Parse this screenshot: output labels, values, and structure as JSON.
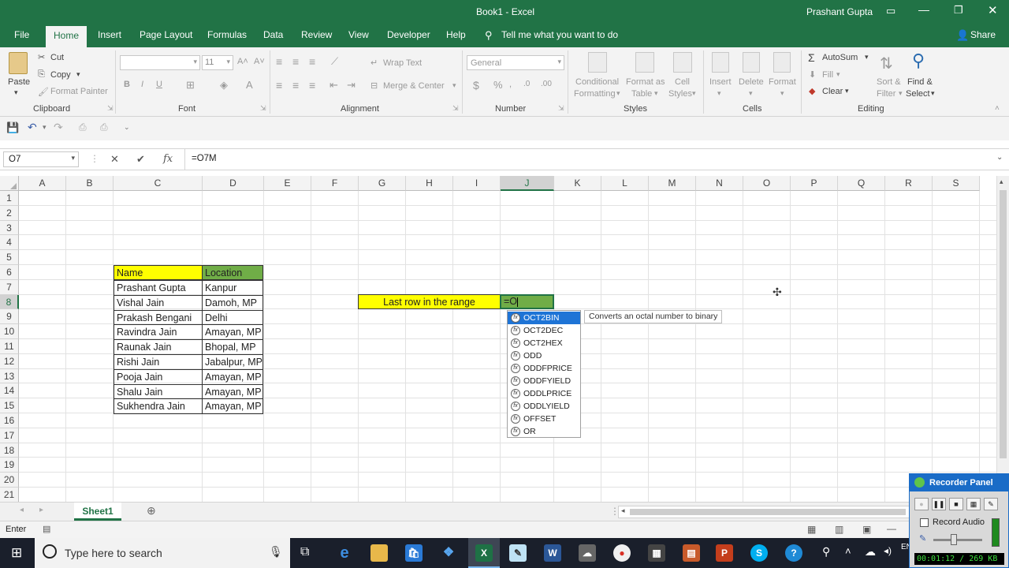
{
  "window": {
    "title": "Book1 - Excel",
    "user": "Prashant Gupta"
  },
  "tabs": [
    "File",
    "Home",
    "Insert",
    "Page Layout",
    "Formulas",
    "Data",
    "Review",
    "View",
    "Developer",
    "Help"
  ],
  "tell_me": "Tell me what you want to do",
  "share": "Share",
  "ribbon": {
    "clipboard": {
      "paste": "Paste",
      "cut": "Cut",
      "copy": "Copy",
      "format_painter": "Format Painter",
      "group": "Clipboard"
    },
    "font": {
      "size": "11",
      "bold": "B",
      "italic": "I",
      "underline": "U",
      "group": "Font"
    },
    "alignment": {
      "wrap_text": "Wrap Text",
      "merge_center": "Merge & Center",
      "group": "Alignment"
    },
    "number": {
      "format": "General",
      "currency": "$",
      "percent": "%",
      "group": "Number"
    },
    "styles": {
      "conditional": "Conditional",
      "formatting": "Formatting",
      "format_as": "Format as",
      "table": "Table",
      "cell": "Cell",
      "styles": "Styles",
      "group": "Styles"
    },
    "cells": {
      "insert": "Insert",
      "delete": "Delete",
      "format": "Format",
      "group": "Cells"
    },
    "editing": {
      "autosum": "AutoSum",
      "fill": "Fill",
      "clear": "Clear",
      "sort": "Sort &",
      "filter": "Filter",
      "find": "Find &",
      "select": "Select",
      "group": "Editing"
    }
  },
  "formula_bar": {
    "name_box": "O7",
    "cancel": "✕",
    "enter": "✔",
    "fx": "fx",
    "formula": "=O7M"
  },
  "columns": [
    "A",
    "B",
    "C",
    "D",
    "E",
    "F",
    "G",
    "H",
    "I",
    "J",
    "K",
    "L",
    "M",
    "N",
    "O",
    "P",
    "Q",
    "R",
    "S"
  ],
  "rows": [
    "1",
    "2",
    "3",
    "4",
    "5",
    "6",
    "7",
    "8",
    "9",
    "10",
    "11",
    "12",
    "13",
    "14",
    "15",
    "16",
    "17",
    "18",
    "19",
    "20",
    "21"
  ],
  "table": {
    "headers": [
      "Name",
      "Location"
    ],
    "rows": [
      [
        "Prashant Gupta",
        "Kanpur"
      ],
      [
        "Vishal Jain",
        "Damoh, MP"
      ],
      [
        "Prakash Bengani",
        "Delhi"
      ],
      [
        "Ravindra Jain",
        "Amayan, MP"
      ],
      [
        "Raunak Jain",
        "Bhopal, MP"
      ],
      [
        "Rishi Jain",
        "Jabalpur, MP"
      ],
      [
        "Pooja Jain",
        "Amayan, MP"
      ],
      [
        "Shalu Jain",
        "Amayan, MP"
      ],
      [
        "Sukhendra Jain",
        "Amayan, MP"
      ]
    ]
  },
  "label_cell": "Last row in the range",
  "editing_cell": "=O",
  "autocomplete": {
    "items": [
      "OCT2BIN",
      "OCT2DEC",
      "OCT2HEX",
      "ODD",
      "ODDFPRICE",
      "ODDFYIELD",
      "ODDLPRICE",
      "ODDLYIELD",
      "OFFSET",
      "OR"
    ],
    "selected_index": 0,
    "tooltip": "Converts an octal number to binary"
  },
  "sheet_tab": "Sheet1",
  "status": "Enter",
  "taskbar": {
    "search_placeholder": "Type here to search",
    "lang": "EN"
  },
  "recorder": {
    "title": "Recorder Panel",
    "record_audio": "Record Audio",
    "readout": "00:01:12 / 269 KB"
  },
  "colors": {
    "excel_green": "#217346",
    "yellow": "#ffff00",
    "green_cell": "#70ad47",
    "selection": "#1e74d6"
  }
}
